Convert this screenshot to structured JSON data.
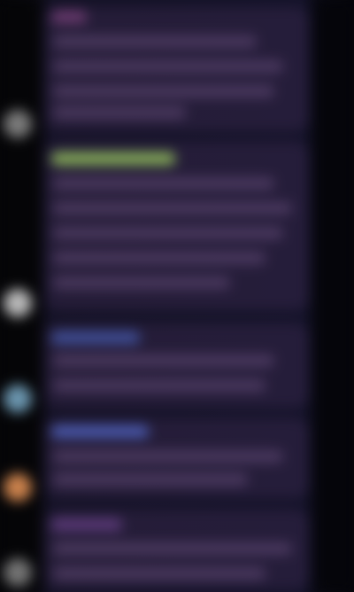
{
  "colors": {
    "background": "#07070c",
    "panel": "#15132a",
    "avatar_1": "#7a7a7a",
    "avatar_2": "#b8b8b8",
    "avatar_3": "#6a94ad",
    "avatar_4": "#c9814c",
    "avatar_5": "#737373",
    "name_green": "#9ccc65",
    "name_purple": "#5b3a78",
    "name_blue": "#4b5bb0"
  },
  "messages": [
    {
      "avatar_icon": "user-avatar"
    },
    {
      "avatar_icon": "user-avatar"
    },
    {
      "avatar_icon": "user-avatar"
    },
    {
      "avatar_icon": "user-avatar"
    },
    {
      "avatar_icon": "user-avatar"
    }
  ]
}
